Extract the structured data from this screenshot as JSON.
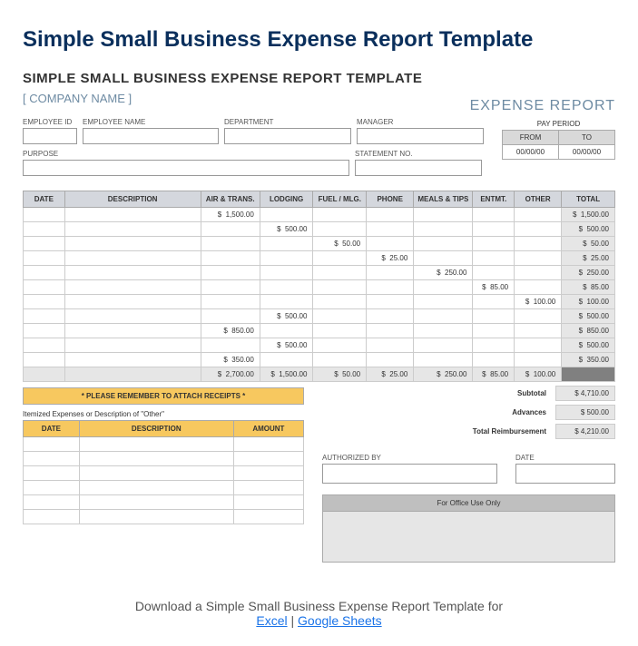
{
  "page_title": "Simple Small Business Expense Report Template",
  "sheet_title": "SIMPLE SMALL BUSINESS EXPENSE REPORT TEMPLATE",
  "company_name": "[ COMPANY NAME ]",
  "expense_report_label": "EXPENSE REPORT",
  "labels": {
    "employee_id": "EMPLOYEE ID",
    "employee_name": "EMPLOYEE NAME",
    "department": "DEPARTMENT",
    "manager": "MANAGER",
    "purpose": "PURPOSE",
    "statement_no": "STATEMENT NO.",
    "pay_period": "PAY PERIOD",
    "from": "FROM",
    "to": "TO",
    "authorized_by": "AUTHORIZED BY",
    "date": "DATE",
    "office_use": "For Office Use Only",
    "attach_receipts": "* PLEASE REMEMBER TO ATTACH RECEIPTS *",
    "itemized": "Itemized Expenses or Description of \"Other\"",
    "subtotal": "Subtotal",
    "advances": "Advances",
    "total_reimbursement": "Total Reimbursement"
  },
  "pay_period": {
    "from": "00/00/00",
    "to": "00/00/00"
  },
  "columns": [
    "DATE",
    "DESCRIPTION",
    "AIR & TRANS.",
    "LODGING",
    "FUEL / MLG.",
    "PHONE",
    "MEALS & TIPS",
    "ENTMT.",
    "OTHER",
    "TOTAL"
  ],
  "itemized_columns": [
    "DATE",
    "DESCRIPTION",
    "AMOUNT"
  ],
  "chart_data": {
    "type": "table",
    "columns": [
      "DATE",
      "DESCRIPTION",
      "AIR & TRANS.",
      "LODGING",
      "FUEL / MLG.",
      "PHONE",
      "MEALS & TIPS",
      "ENTMT.",
      "OTHER",
      "TOTAL"
    ],
    "rows": [
      {
        "air": "1,500.00",
        "total": "1,500.00"
      },
      {
        "lodging": "500.00",
        "total": "500.00"
      },
      {
        "fuel": "50.00",
        "total": "50.00"
      },
      {
        "phone": "25.00",
        "total": "25.00"
      },
      {
        "meals": "250.00",
        "total": "250.00"
      },
      {
        "entmt": "85.00",
        "total": "85.00"
      },
      {
        "other": "100.00",
        "total": "100.00"
      },
      {
        "lodging": "500.00",
        "total": "500.00"
      },
      {
        "air": "850.00",
        "total": "850.00"
      },
      {
        "lodging": "500.00",
        "total": "500.00"
      },
      {
        "air": "350.00",
        "total": "350.00"
      }
    ],
    "totals": {
      "air": "2,700.00",
      "lodging": "1,500.00",
      "fuel": "50.00",
      "phone": "25.00",
      "meals": "250.00",
      "entmt": "85.00",
      "other": "100.00"
    },
    "subtotal": "4,710.00",
    "advances": "500.00",
    "total_reimbursement": "4,210.00"
  },
  "download": {
    "text": "Download a Simple Small Business Expense Report Template for",
    "excel": "Excel",
    "sep": " | ",
    "google_sheets": "Google Sheets"
  }
}
